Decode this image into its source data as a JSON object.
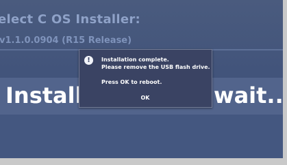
{
  "header": {
    "title": "elect C OS Installer:",
    "version": "v1.1.0.0904 (R15 Release)"
  },
  "banner": {
    "left_text": "Install",
    "right_text": "wait..."
  },
  "dialog": {
    "icon": "info-icon",
    "line1": "Installation complete.",
    "line2": "Please remove the USB flash drive.",
    "line3": "Press OK to reboot.",
    "ok_label": "OK"
  },
  "colors": {
    "screen_background": "#42547b",
    "dialog_background": "#3a4363",
    "text": "#ffffff",
    "header_text": "#8fa2c8"
  }
}
